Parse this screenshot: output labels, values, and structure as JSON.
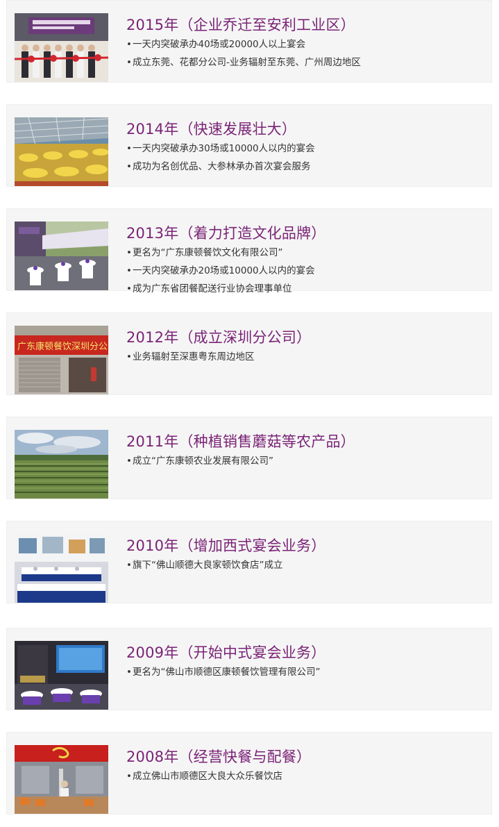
{
  "milestones": [
    {
      "title": "2015年（企业乔迁至安利工业区）",
      "thumb": "ribbon-cutting-ceremony",
      "bullets": [
        "一天内突破承办40场或20000人以上宴会",
        "成立东莞、花都分公司-业务辐射至东莞、广州周边地区"
      ]
    },
    {
      "title": "2014年（快速发展壮大）",
      "thumb": "outdoor-banquet-tent",
      "bullets": [
        "一天内突破承办30场或10000人以内的宴会",
        "成功为名创优品、大参林承办首次宴会服务"
      ]
    },
    {
      "title": "2013年（着力打造文化品牌）",
      "thumb": "outdoor-buffet-setup",
      "bullets": [
        "更名为“广东康顿餐饮文化有限公司”",
        "一天内突破承办20场或10000人以内的宴会",
        "成为广东省团餐配送行业协会理事单位"
      ]
    },
    {
      "title": "2012年（成立深圳分公司）",
      "thumb": "shenzhen-branch-storefront",
      "thumb_sign": "广东康顿餐饮深圳分公",
      "bullets": [
        "业务辐射至深惠粤东周边地区"
      ]
    },
    {
      "title": "2011年（种植销售蘑菇等农产品）",
      "thumb": "farmland",
      "bullets": [
        "成立“广东康顿农业发展有限公司”"
      ]
    },
    {
      "title": "2010年（增加西式宴会业务）",
      "thumb": "western-banquet-hall",
      "bullets": [
        "旗下“佛山顺德大良家顿饮食店”成立"
      ]
    },
    {
      "title": "2009年（开始中式宴会业务）",
      "thumb": "chinese-banquet-stage",
      "bullets": [
        "更名为“佛山市顺德区康顿餐饮管理有限公司”"
      ]
    },
    {
      "title": "2008年（经营快餐与配餐）",
      "thumb": "fast-food-restaurant",
      "bullets": [
        "成立佛山市顺德区大良大众乐餐饮店"
      ]
    }
  ],
  "colors": {
    "title": "#7a2376",
    "card_bg": "#f5f5f5",
    "text": "#333333"
  }
}
